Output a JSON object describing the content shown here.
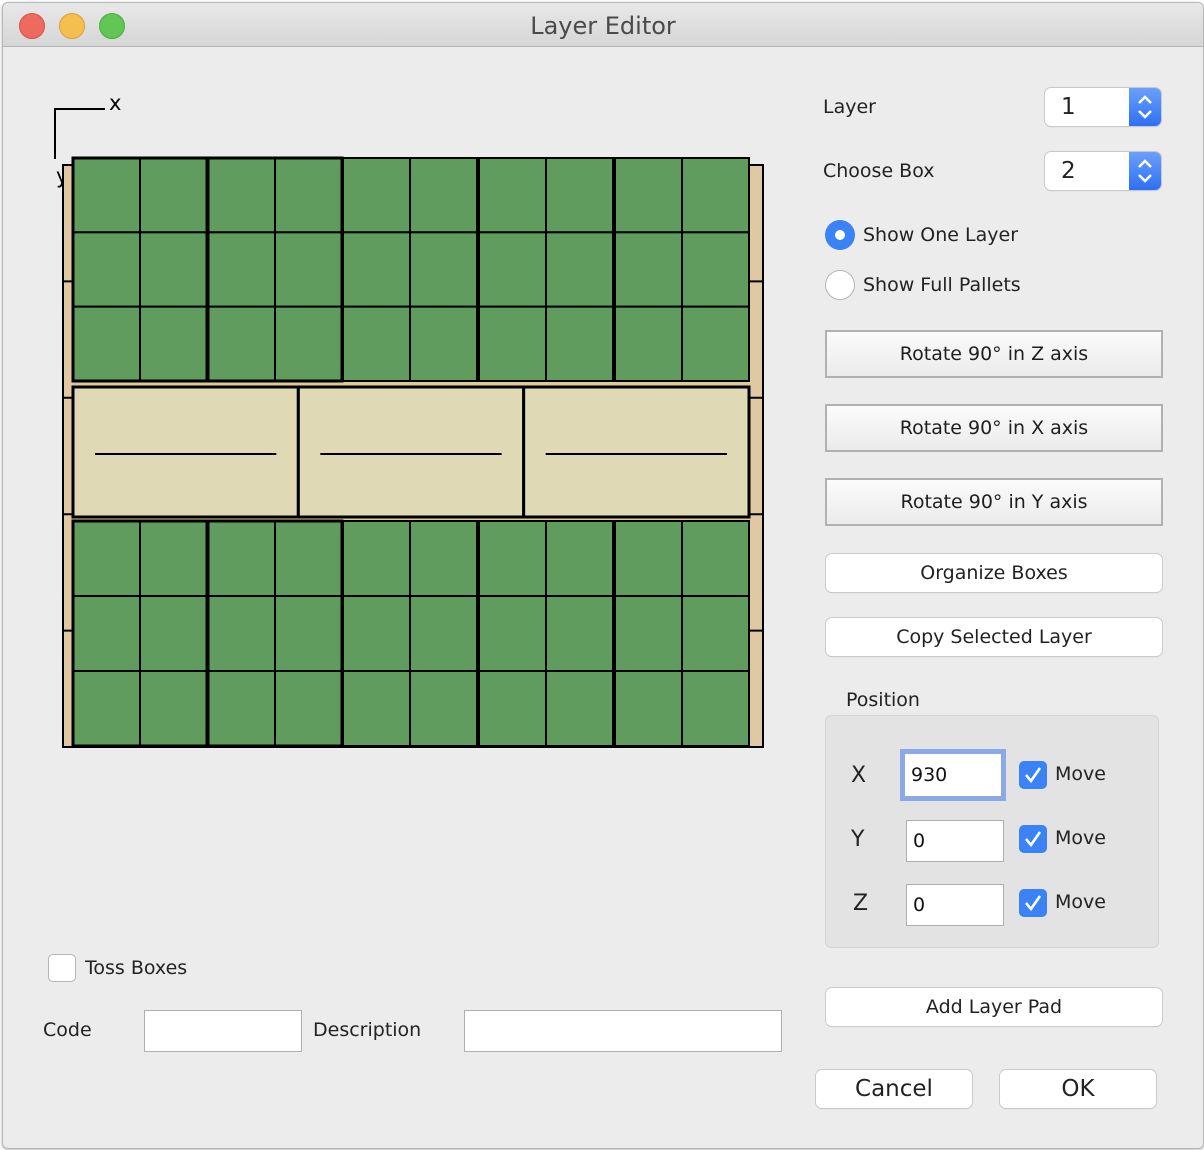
{
  "window": {
    "title": "Layer Editor"
  },
  "canvas": {
    "axis": {
      "x_label": "x",
      "y_label": "y"
    },
    "colors": {
      "pallet": "#e0c9a2",
      "box": "#609c5d",
      "selected_box": "#dfdab5",
      "outline": "#000000",
      "background": "#ececec"
    },
    "pallet": {
      "slats": 5
    },
    "top_groups": [
      {
        "cols": 2,
        "rows": 3
      },
      {
        "cols": 2,
        "rows": 3
      },
      {
        "cols": 2,
        "rows": 3
      },
      {
        "cols": 2,
        "rows": 3
      },
      {
        "cols": 2,
        "rows": 3
      }
    ],
    "middle_boxes": 3,
    "bottom_groups": [
      {
        "cols": 2,
        "rows": 3
      },
      {
        "cols": 2,
        "rows": 3
      },
      {
        "cols": 2,
        "rows": 3
      },
      {
        "cols": 2,
        "rows": 3
      },
      {
        "cols": 2,
        "rows": 3
      }
    ]
  },
  "controls": {
    "layer": {
      "label": "Layer",
      "value": "1"
    },
    "choose_box": {
      "label": "Choose Box",
      "value": "2"
    },
    "view_mode": {
      "options": [
        "Show One Layer",
        "Show Full Pallets"
      ],
      "selected": "Show One Layer"
    },
    "rotate_z": "Rotate 90° in Z axis",
    "rotate_x": "Rotate 90° in X axis",
    "rotate_y": "Rotate 90° in Y axis",
    "organize": "Organize Boxes",
    "copy_layer": "Copy Selected Layer",
    "position": {
      "title": "Position",
      "rows": [
        {
          "axis": "X",
          "value": "930",
          "move_label": "Move",
          "move_checked": true
        },
        {
          "axis": "Y",
          "value": "0",
          "move_label": "Move",
          "move_checked": true
        },
        {
          "axis": "Z",
          "value": "0",
          "move_label": "Move",
          "move_checked": true
        }
      ]
    },
    "add_layer_pad": "Add Layer Pad",
    "cancel": "Cancel",
    "ok": "OK"
  },
  "bottom": {
    "toss_boxes": {
      "label": "Toss Boxes",
      "checked": false
    },
    "code": {
      "label": "Code",
      "value": ""
    },
    "description": {
      "label": "Description",
      "value": ""
    }
  }
}
